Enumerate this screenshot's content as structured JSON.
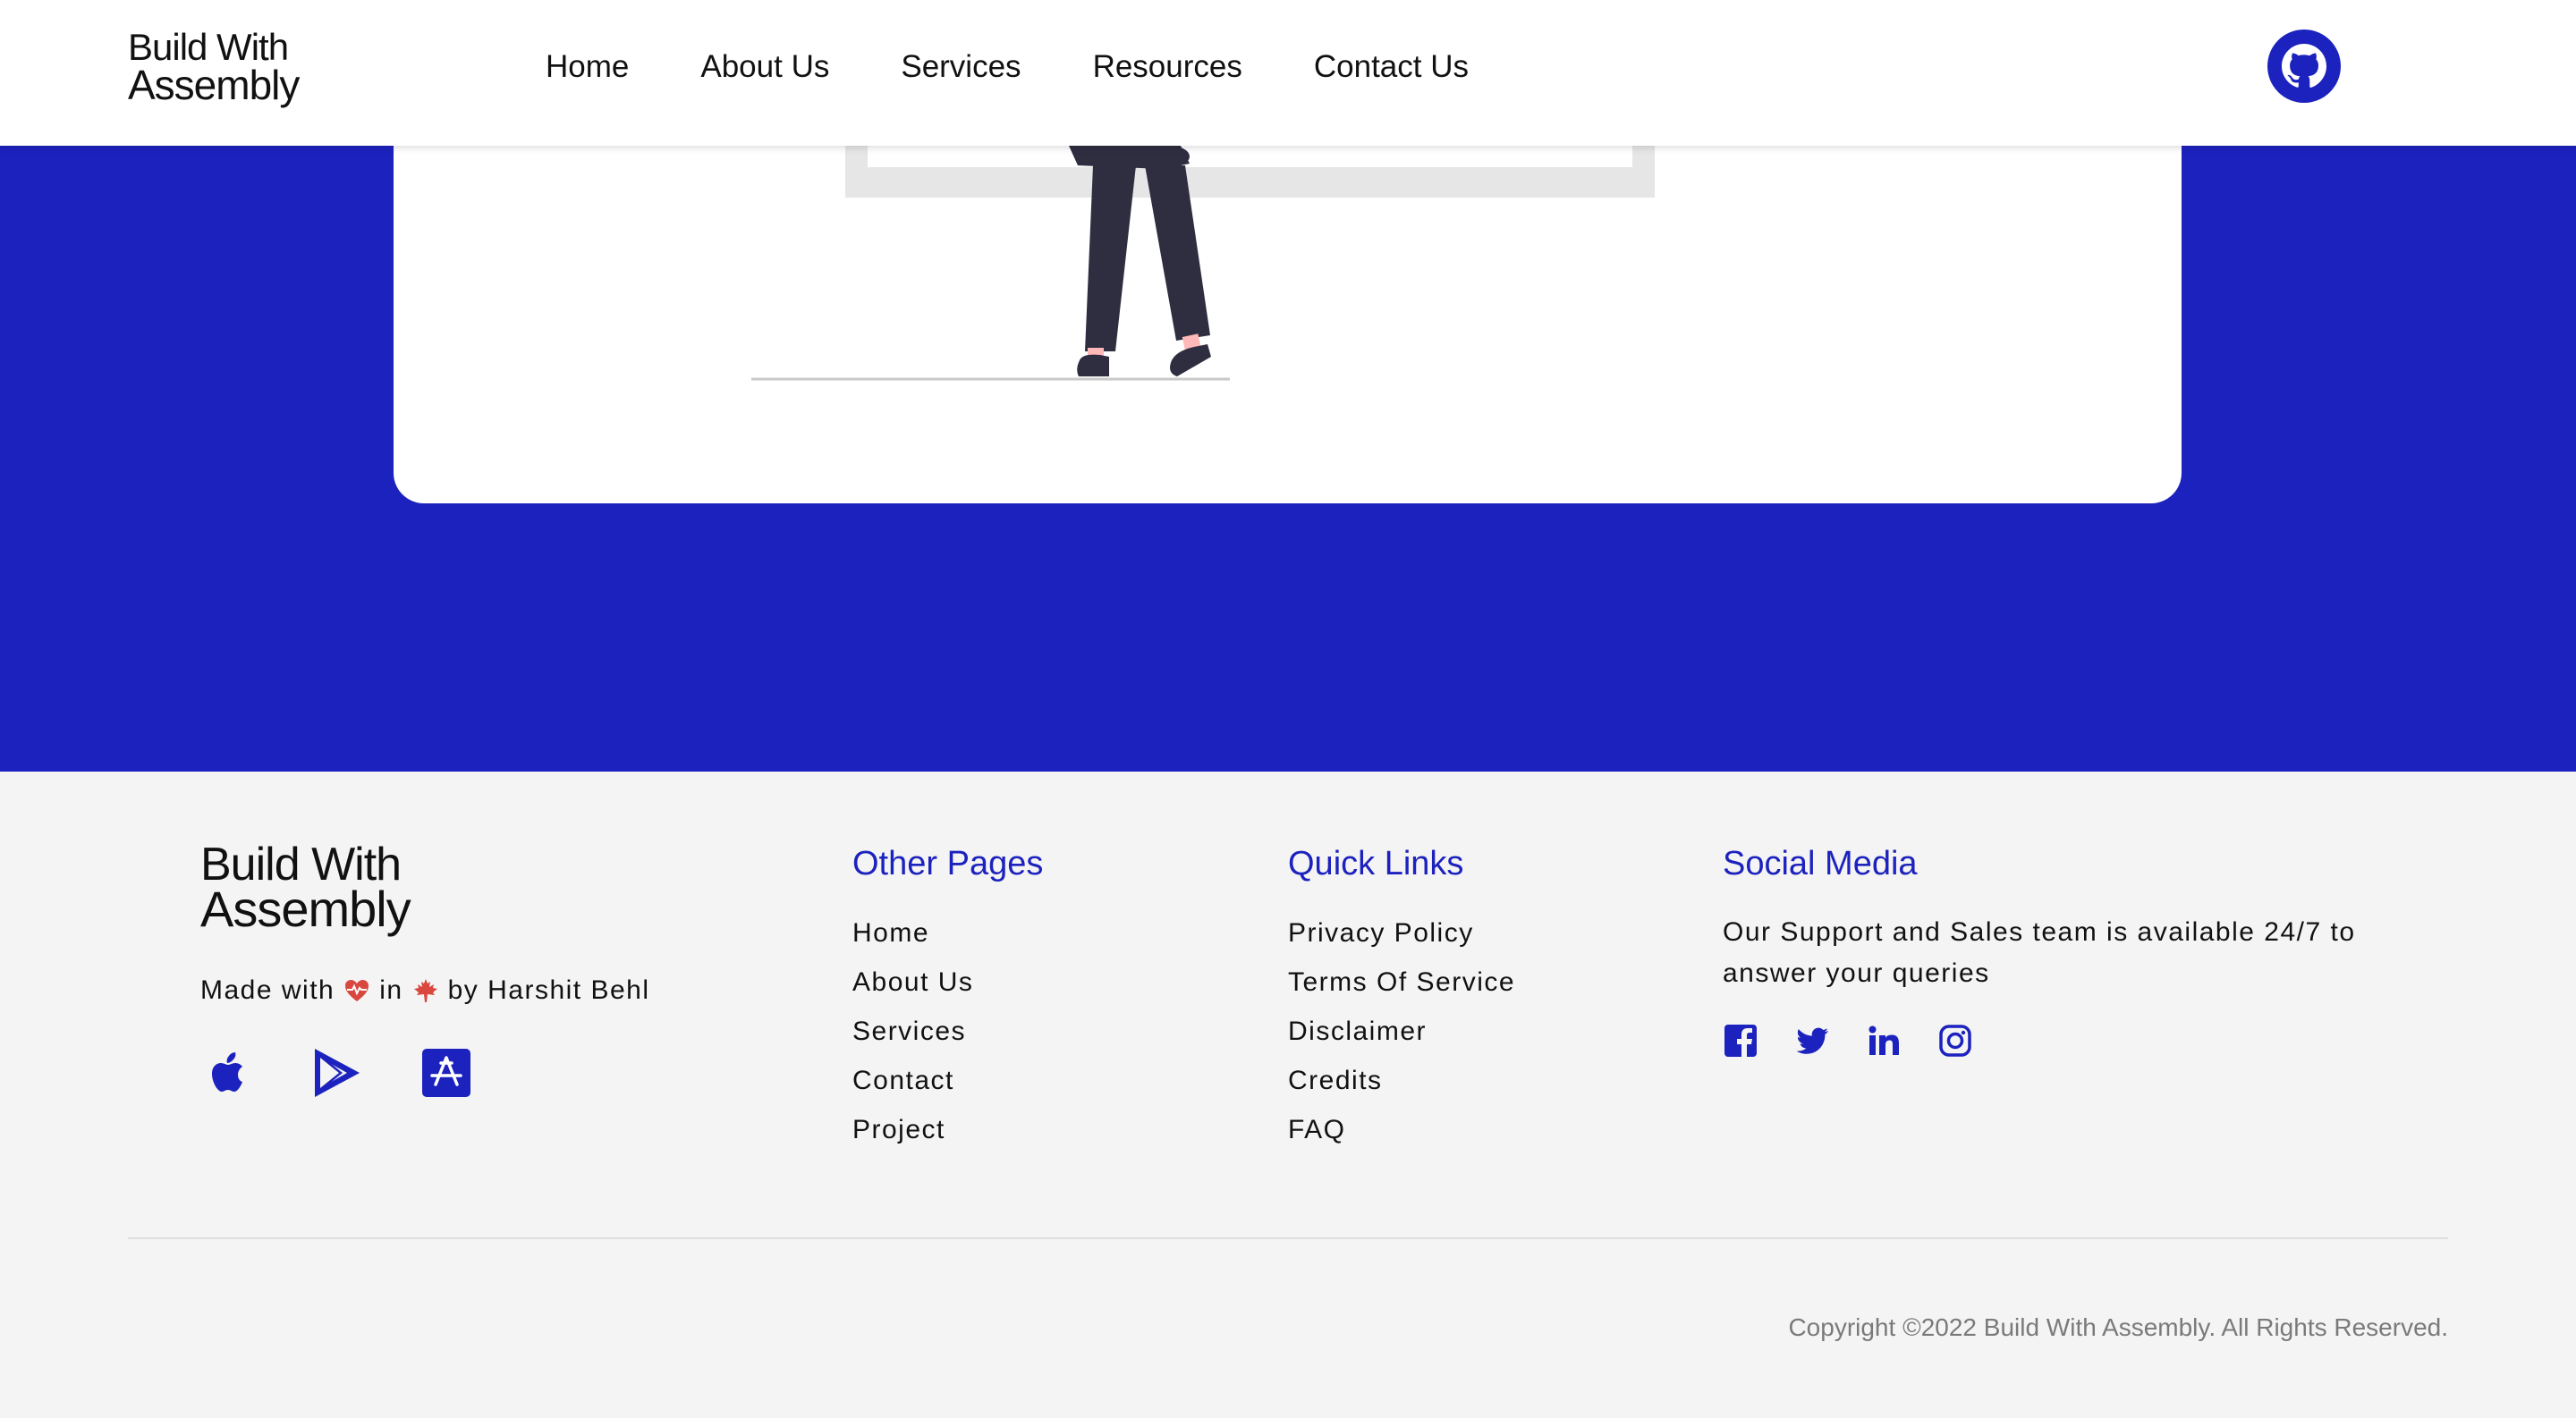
{
  "header": {
    "logo_line1": "Build With",
    "logo_line2": "Assembly",
    "nav": [
      "Home",
      "About Us",
      "Services",
      "Resources",
      "Contact Us"
    ],
    "github_icon": "github-icon"
  },
  "footer": {
    "logo_line1": "Build With",
    "logo_line2": "Assembly",
    "made_with": "Made with",
    "made_in": "in",
    "made_by": "by Harshit Behl",
    "heart_icon": "heart-pulse-icon",
    "flag_icon": "maple-leaf-icon",
    "app_icons": [
      "apple-icon",
      "google-play-icon",
      "app-store-icon"
    ],
    "other_pages": {
      "title": "Other Pages",
      "links": [
        "Home",
        "About Us",
        "Services",
        "Contact",
        "Project"
      ]
    },
    "quick_links": {
      "title": "Quick Links",
      "links": [
        "Privacy Policy",
        "Terms Of Service",
        "Disclaimer",
        "Credits",
        "FAQ"
      ]
    },
    "social_media": {
      "title": "Social Media",
      "text": "Our Support and Sales team is available 24/7 to answer your queries",
      "icons": [
        "facebook-icon",
        "twitter-icon",
        "linkedin-icon",
        "instagram-icon"
      ]
    },
    "copyright": "Copyright ©2022 Build With Assembly. All Rights Reserved."
  },
  "colors": {
    "brand_blue": "#1c22bd",
    "heart_red": "#d9473f",
    "text_dark": "#111111",
    "footer_bg": "#f4f4f4"
  }
}
